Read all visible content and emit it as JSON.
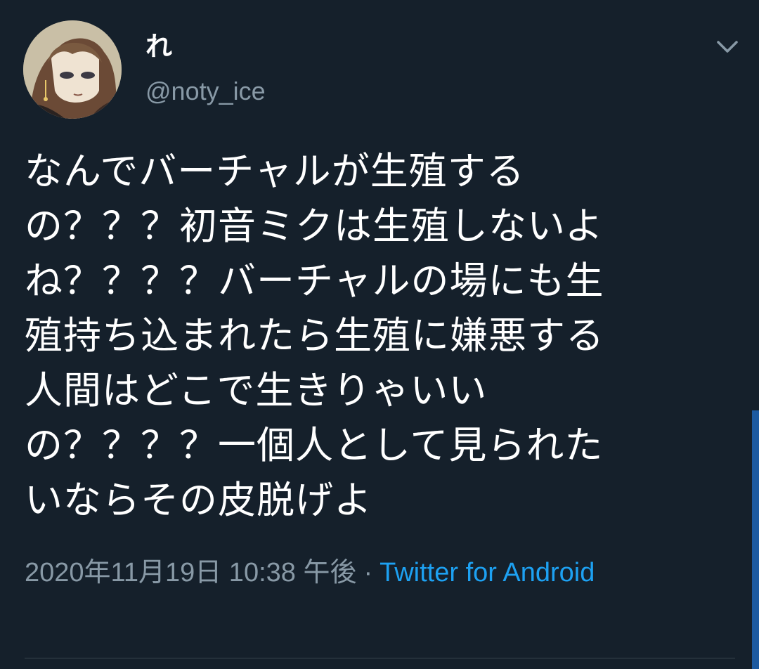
{
  "user": {
    "display_name": "れ",
    "handle": "@noty_ice",
    "avatar_icon": "avatar-illustration"
  },
  "tweet": {
    "text": "なんでバーチャルが生殖する\nの？？？初音ミクは生殖しないよ\nね？？？？バーチャルの場にも生\n殖持ち込まれたら生殖に嫌悪する\n人間はどこで生きりゃいい\nの？？？？一個人として見られた\nいならその皮脱げよ",
    "timestamp": "2020年11月19日 10:38 午後",
    "separator": "·",
    "source": "Twitter for Android"
  },
  "icons": {
    "more": "chevron-down-icon"
  },
  "colors": {
    "background": "#15202b",
    "text": "#ffffff",
    "secondary": "#8899a6",
    "link": "#1da1f2",
    "divider": "#38444d"
  }
}
